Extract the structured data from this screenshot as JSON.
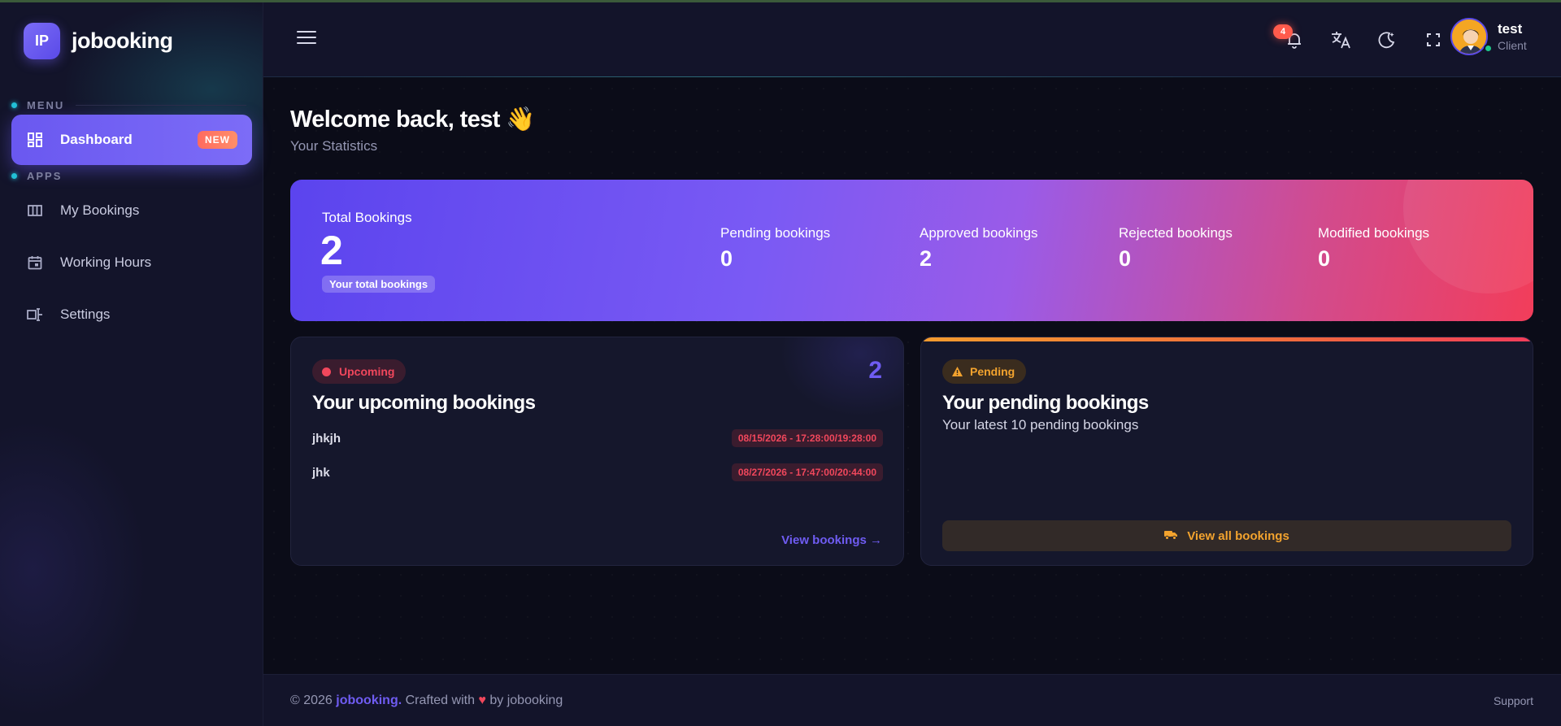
{
  "app": {
    "logo_initials": "IP",
    "logo_name": "jobooking"
  },
  "sidebar": {
    "sections": [
      {
        "label": "MENU"
      },
      {
        "label": "APPS"
      }
    ],
    "items": [
      {
        "label": "Dashboard",
        "badge": "NEW",
        "icon": "dashboard-icon",
        "active": true
      },
      {
        "label": "My Bookings",
        "icon": "columns-icon"
      },
      {
        "label": "Working Hours",
        "icon": "calendar-icon"
      },
      {
        "label": "Settings",
        "icon": "settings-icon"
      }
    ]
  },
  "header": {
    "notification_count": "4",
    "user": {
      "name": "test",
      "role": "Client"
    }
  },
  "main": {
    "welcome": "Welcome back, test 👋",
    "subtitle": "Your Statistics",
    "stats": {
      "total_label": "Total Bookings",
      "total_value": "2",
      "total_tag": "Your total bookings",
      "items": [
        {
          "label": "Pending bookings",
          "value": "0"
        },
        {
          "label": "Approved bookings",
          "value": "2"
        },
        {
          "label": "Rejected bookings",
          "value": "0"
        },
        {
          "label": "Modified bookings",
          "value": "0"
        }
      ]
    },
    "upcoming": {
      "pill": "Upcoming",
      "count": "2",
      "title": "Your upcoming bookings",
      "bookings": [
        {
          "name": "jhkjh",
          "time": "08/15/2026 - 17:28:00/19:28:00"
        },
        {
          "name": "jhk",
          "time": "08/27/2026 - 17:47:00/20:44:00"
        }
      ],
      "link": "View bookings →"
    },
    "pending": {
      "pill": "Pending",
      "title": "Your pending bookings",
      "subtitle": "Your latest 10 pending bookings",
      "button": "View all bookings"
    }
  },
  "footer": {
    "prefix": "© 2026 ",
    "brand": "jobooking.",
    "mid": " Crafted with ",
    "heart": "♥",
    "suffix": " by jobooking",
    "support": "Support"
  },
  "colors": {
    "accent": "#6f5cf2",
    "danger": "#f1475c",
    "warning": "#f3a32e",
    "online": "#1ec98c"
  }
}
